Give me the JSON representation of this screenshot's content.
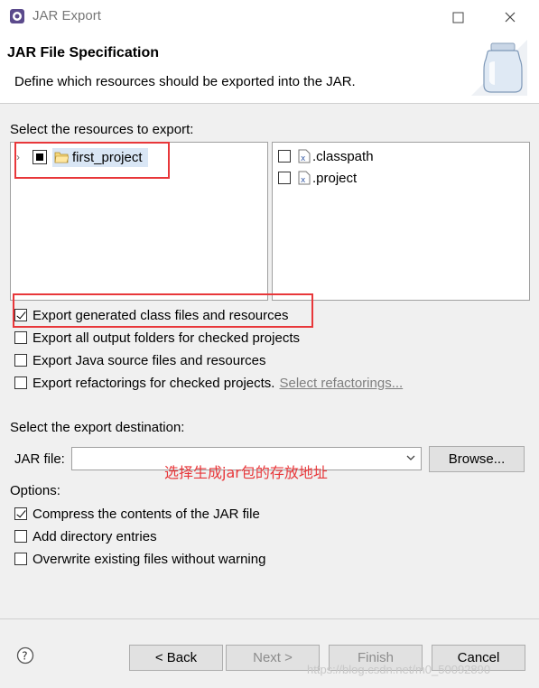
{
  "window": {
    "title": "JAR Export",
    "minimize_glyph": "☐",
    "close_glyph": "✕"
  },
  "header": {
    "title": "JAR File Specification",
    "description": "Define which resources should be exported into the JAR."
  },
  "resources": {
    "label": "Select the resources to export:",
    "tree": [
      {
        "label": "first_project",
        "state": "partial",
        "icon": "folder-icon"
      }
    ],
    "files": [
      {
        "label": ".classpath",
        "checked": false,
        "icon": "xml-file-icon"
      },
      {
        "label": ".project",
        "checked": false,
        "icon": "xml-file-icon"
      }
    ]
  },
  "export_options": [
    {
      "label": "Export generated class files and resources",
      "checked": true
    },
    {
      "label": "Export all output folders for checked projects",
      "checked": false
    },
    {
      "label": "Export Java source files and resources",
      "checked": false
    },
    {
      "label": "Export refactorings for checked projects.",
      "checked": false,
      "link": "Select refactorings..."
    }
  ],
  "destination": {
    "label": "Select the export destination:",
    "jar_label": "JAR file:",
    "jar_value": "",
    "browse": "Browse..."
  },
  "options": {
    "label": "Options:",
    "items": [
      {
        "label": "Compress the contents of the JAR file",
        "checked": true
      },
      {
        "label": "Add directory entries",
        "checked": false
      },
      {
        "label": "Overwrite existing files without warning",
        "checked": false
      }
    ]
  },
  "annotation": "选择生成jar包的存放地址",
  "buttons": {
    "back": "< Back",
    "next": "Next >",
    "finish": "Finish",
    "cancel": "Cancel"
  },
  "watermark": "https://blog.csdn.net/m0_50092890",
  "colors": {
    "highlight_red": "#e8373a",
    "selection_blue": "#d9e6f5"
  }
}
